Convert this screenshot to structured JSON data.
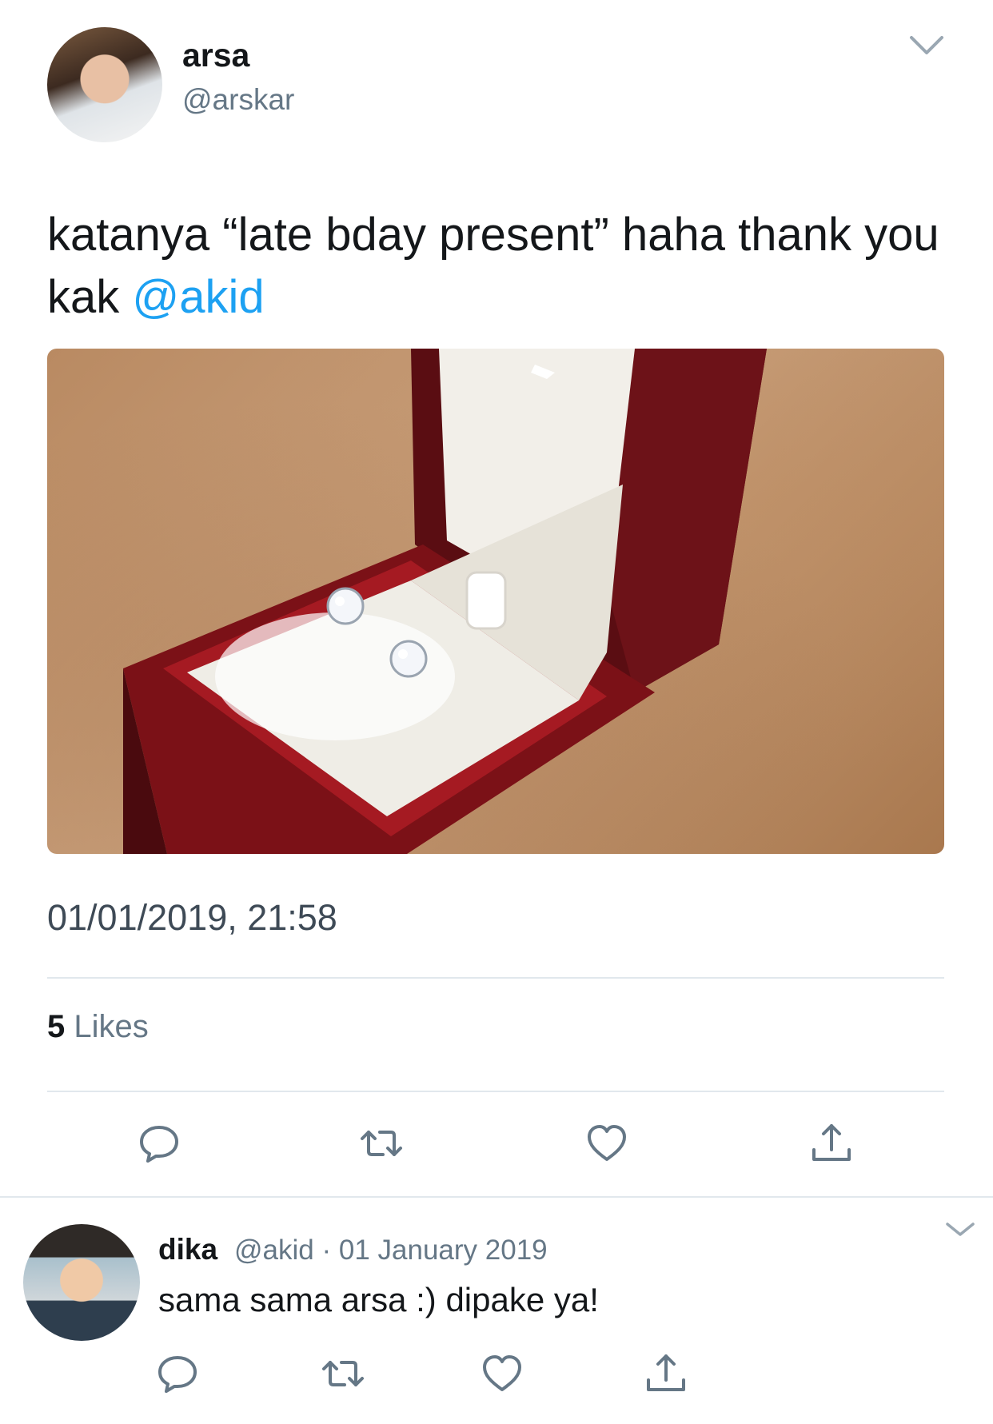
{
  "tweet": {
    "author": {
      "display_name": "arsa",
      "handle": "@arskar"
    },
    "text_before_mention": "katanya “late bday present” haha thank you kak ",
    "mention": "@akid",
    "media_alt_icon": "photo-earrings-box",
    "timestamp": "01/01/2019, 21:58",
    "likes_count": "5",
    "likes_label": "Likes",
    "actions": [
      "reply-icon",
      "retweet-icon",
      "like-icon",
      "share-icon"
    ]
  },
  "reply": {
    "author": {
      "display_name": "dika",
      "handle": "@akid"
    },
    "separator": "·",
    "date": "01 January 2019",
    "text": "sama sama arsa :) dipake ya!",
    "actions": [
      "reply-icon",
      "retweet-icon",
      "like-icon",
      "share-icon"
    ]
  },
  "colors": {
    "link": "#1da1f2",
    "secondary": "#657786",
    "divider": "#e1e8ed"
  }
}
